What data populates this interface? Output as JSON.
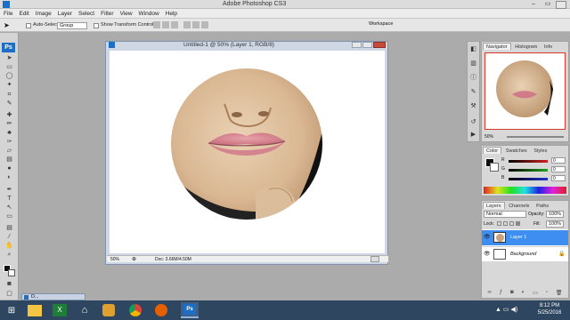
{
  "titlebar": {
    "app_title": "Adobe Photoshop CS3",
    "controls": [
      "–",
      "▭",
      "✕"
    ]
  },
  "menu": [
    "File",
    "Edit",
    "Image",
    "Layer",
    "Select",
    "Filter",
    "View",
    "Window",
    "Help"
  ],
  "options_bar": {
    "auto_select_label": "Auto-Select:",
    "auto_select_value": "Group",
    "show_transform_label": "Show Transform Controls",
    "workspace_label": "Workspace"
  },
  "document": {
    "title": "Untitled-1 @ 50% (Layer 1, RGB/8)",
    "zoom": "50%",
    "doc_size": "Doc: 3.66M/4.50M"
  },
  "navigator": {
    "tabs": [
      "Navigator",
      "Histogram",
      "Info"
    ],
    "zoom": "50%"
  },
  "color_panel": {
    "tabs": [
      "Color",
      "Swatches",
      "Styles"
    ],
    "channels": [
      {
        "label": "R",
        "value": "0",
        "color": "#d22020"
      },
      {
        "label": "G",
        "value": "0",
        "color": "#20a020"
      },
      {
        "label": "B",
        "value": "0",
        "color": "#2030d0"
      }
    ]
  },
  "layers_panel": {
    "tabs": [
      "Layers",
      "Channels",
      "Paths"
    ],
    "blend_mode": "Normal",
    "opacity_label": "Opacity:",
    "opacity_value": "100%",
    "lock_label": "Lock:",
    "fill_label": "Fill:",
    "fill_value": "100%",
    "layers": [
      {
        "name": "Layer 1",
        "selected": true
      },
      {
        "name": "Background",
        "selected": false
      }
    ]
  },
  "minimized_tab": "D...",
  "taskbar": {
    "time": "8:12 PM",
    "date": "5/25/2016"
  },
  "colors": {
    "accent": "#3d8ef0",
    "titlebar": "#dcdcdc",
    "workspace_bg": "#ababab"
  }
}
